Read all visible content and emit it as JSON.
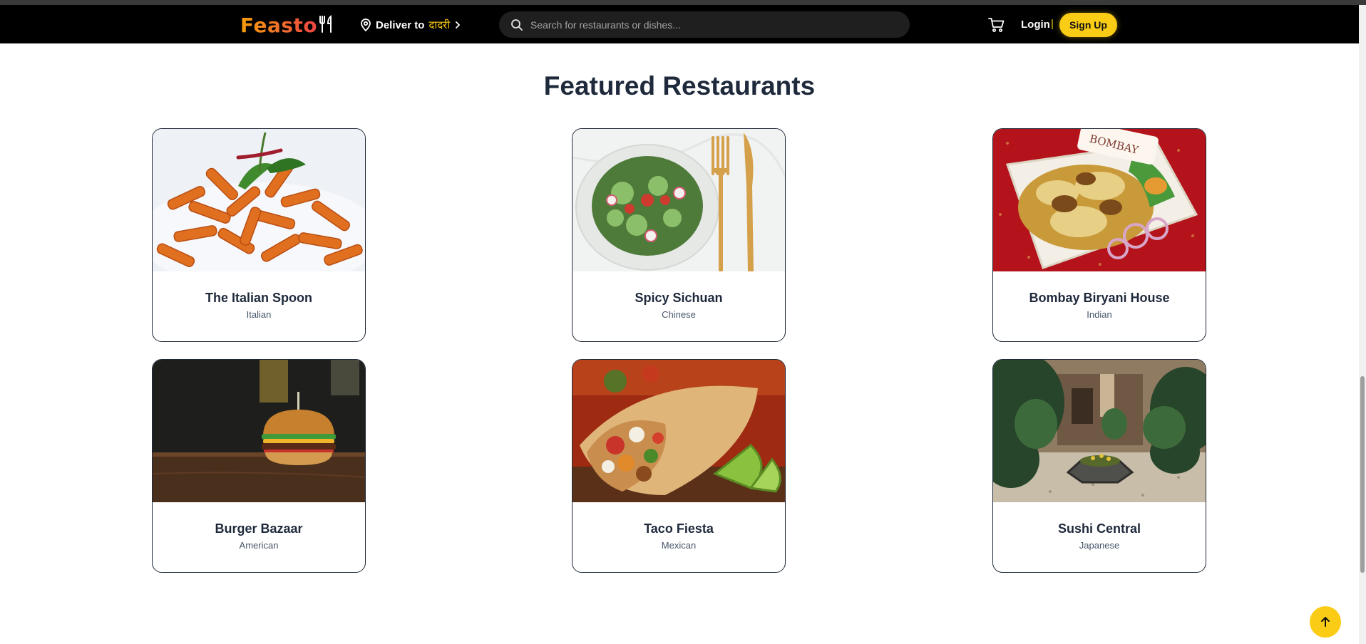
{
  "header": {
    "logo": "Feasto",
    "deliver_label": "Deliver to",
    "location": "दादरी",
    "search_placeholder": "Search for restaurants or dishes...",
    "login_label": "Login",
    "separator": "|",
    "signup_label": "Sign Up"
  },
  "section": {
    "title": "Featured Restaurants"
  },
  "restaurants": [
    {
      "name": "The Italian Spoon",
      "cuisine": "Italian"
    },
    {
      "name": "Spicy Sichuan",
      "cuisine": "Chinese"
    },
    {
      "name": "Bombay Biryani House",
      "cuisine": "Indian"
    },
    {
      "name": "Burger Bazaar",
      "cuisine": "American"
    },
    {
      "name": "Taco Fiesta",
      "cuisine": "Mexican"
    },
    {
      "name": "Sushi Central",
      "cuisine": "Japanese"
    }
  ],
  "colors": {
    "accent": "#facc15",
    "navbar": "#000000",
    "logo_gradient_start": "#f59e0b",
    "logo_gradient_end": "#ef4444"
  },
  "icons": [
    "fork-knife-icon",
    "location-pin-icon",
    "chevron-right-icon",
    "search-icon",
    "cart-icon",
    "arrow-up-icon"
  ]
}
